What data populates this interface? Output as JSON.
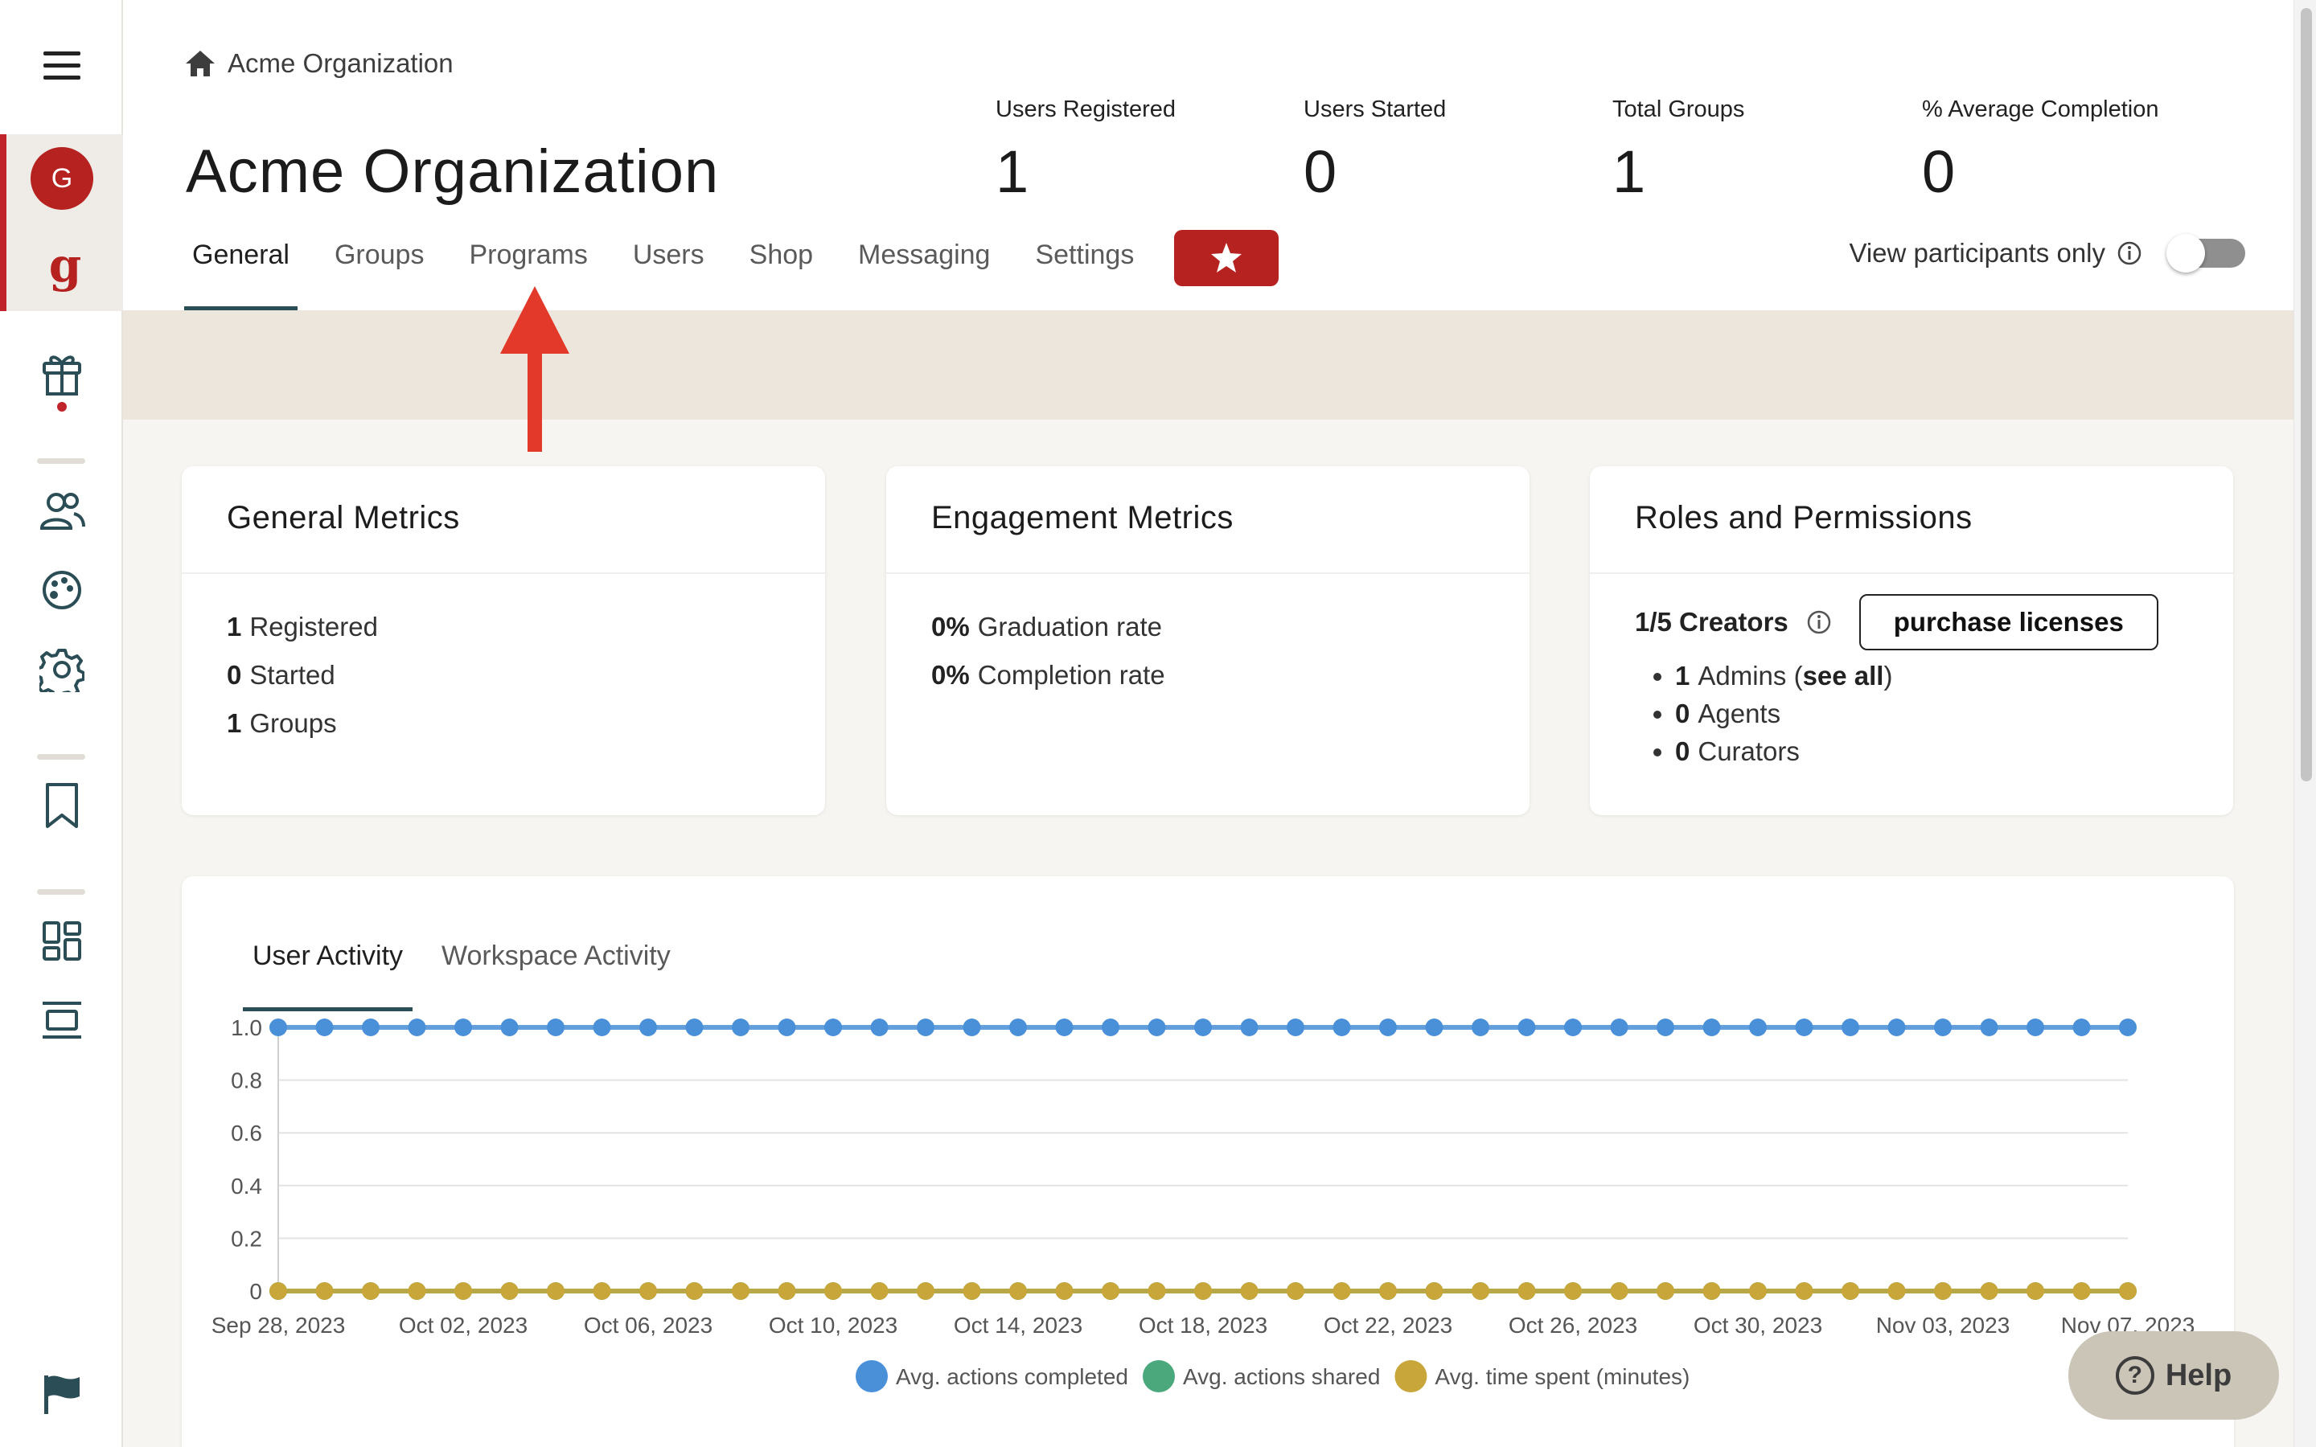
{
  "breadcrumb": {
    "label": "Acme Organization"
  },
  "page_title": "Acme Organization",
  "stats": [
    {
      "label": "Users Registered",
      "value": "1"
    },
    {
      "label": "Users Started",
      "value": "0"
    },
    {
      "label": "Total Groups",
      "value": "1"
    },
    {
      "label": "% Average Completion",
      "value": "0"
    }
  ],
  "tabs": [
    "General",
    "Groups",
    "Programs",
    "Users",
    "Shop",
    "Messaging",
    "Settings"
  ],
  "active_tab": "General",
  "view_participants": {
    "label": "View participants only",
    "enabled": false
  },
  "sidebar": {
    "avatar_letter": "G",
    "brand_letter": "g"
  },
  "general_metrics": {
    "title": "General Metrics",
    "rows": [
      {
        "value": "1",
        "label": "Registered"
      },
      {
        "value": "0",
        "label": "Started"
      },
      {
        "value": "1",
        "label": "Groups"
      }
    ]
  },
  "engagement_metrics": {
    "title": "Engagement Metrics",
    "rows": [
      {
        "value": "0%",
        "label": "Graduation rate"
      },
      {
        "value": "0%",
        "label": "Completion rate"
      }
    ]
  },
  "roles": {
    "title": "Roles and Permissions",
    "creators": "1/5 Creators",
    "purchase_label": "purchase licenses",
    "items": [
      {
        "value": "1",
        "label": "Admins (",
        "link": "see all",
        "suffix": ")"
      },
      {
        "value": "0",
        "label": "Agents"
      },
      {
        "value": "0",
        "label": "Curators"
      }
    ]
  },
  "activity_tabs": [
    "User Activity",
    "Workspace Activity"
  ],
  "help_label": "Help",
  "colors": {
    "accent_red": "#b5221f",
    "teal": "#2b4e56",
    "series_blue": "#4a90d9",
    "series_green": "#4aa87c",
    "series_gold": "#c8a63a"
  },
  "chart_data": {
    "type": "line",
    "x_start": "2023-09-28",
    "x_end": "2023-11-07",
    "tick_labels": [
      "Sep 28, 2023",
      "Oct 02, 2023",
      "Oct 06, 2023",
      "Oct 10, 2023",
      "Oct 14, 2023",
      "Oct 18, 2023",
      "Oct 22, 2023",
      "Oct 26, 2023",
      "Oct 30, 2023",
      "Nov 03, 2023",
      "Nov 07, 2023"
    ],
    "ylim": [
      0,
      1
    ],
    "yticks": [
      "0",
      "0.2",
      "0.4",
      "0.6",
      "0.8",
      "1.0"
    ],
    "grid": true,
    "legend_position": "bottom-center",
    "series": [
      {
        "name": "Avg. actions completed",
        "color": "#4a90d9",
        "constant_value": 1
      },
      {
        "name": "Avg. actions shared",
        "color": "#4aa87c",
        "constant_value": 0
      },
      {
        "name": "Avg. time spent (minutes)",
        "color": "#c8a63a",
        "constant_value": 0
      }
    ]
  }
}
